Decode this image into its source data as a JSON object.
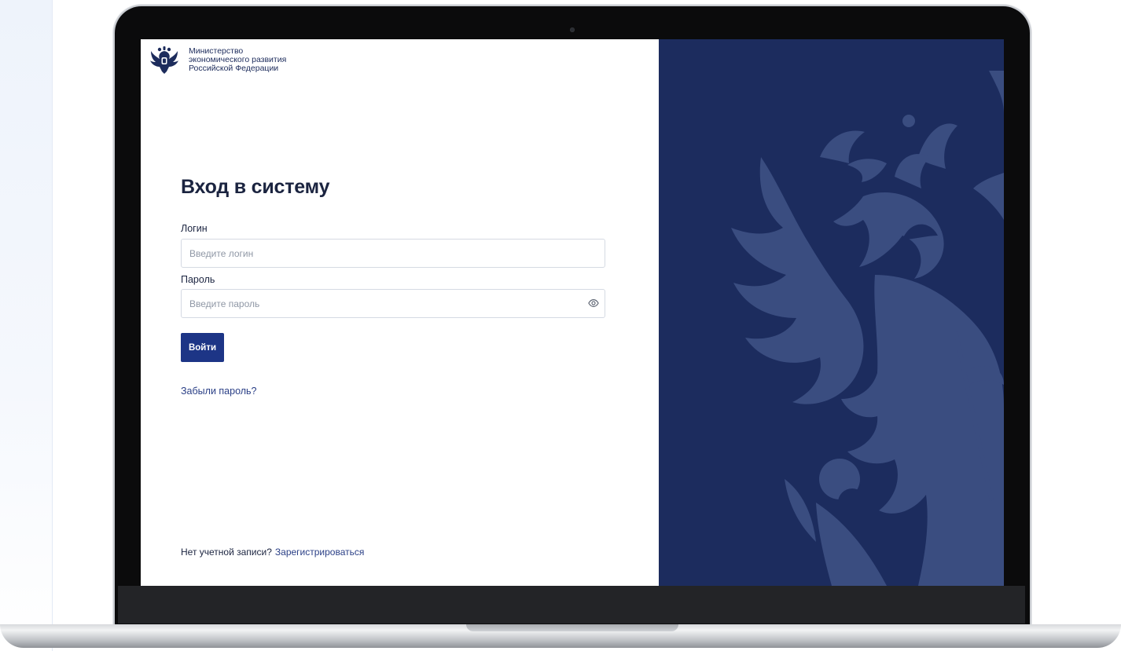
{
  "brand": {
    "ministry_line1": "Министерство",
    "ministry_line2": "экономического развития",
    "ministry_line3": "Российской Федерации",
    "emblem_icon": "double-headed-eagle-icon"
  },
  "login_form": {
    "title": "Вход в систему",
    "login_label": "Логин",
    "login_placeholder": "Введите логин",
    "login_value": "",
    "password_label": "Пароль",
    "password_placeholder": "Введите пароль",
    "password_value": "",
    "show_password_icon": "eye-icon",
    "submit_label": "Войти",
    "forgot_link": "Забыли пароль?"
  },
  "footer": {
    "no_account_text": "Нет учетной записи?",
    "register_link": "Зарегистрироваться"
  },
  "colors": {
    "primary": "#1d3586",
    "panel_background": "#1c2c5e",
    "panel_art": "#3a4d80",
    "text": "#1b2440"
  }
}
